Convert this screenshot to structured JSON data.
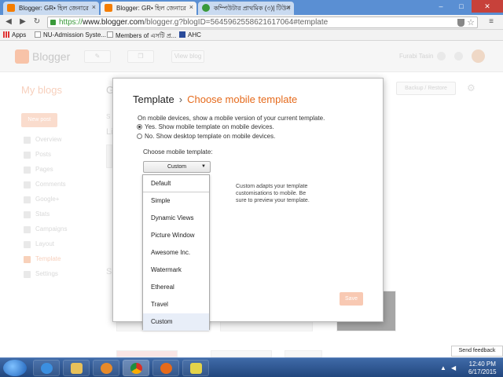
{
  "browser": {
    "tabs": [
      {
        "label": "Blogger: GR• হিল জেনারে",
        "active": false
      },
      {
        "label": "Blogger: GR• হিল জেনারে",
        "active": true
      },
      {
        "label": "কম্পিউটার প্রাথমিক (৩)| টিউন",
        "active": false
      }
    ],
    "url": {
      "scheme": "https://",
      "host": "www.blogger.com",
      "path": "/blogger.g?blogID=5645962558621617064#template"
    },
    "bookmarks": [
      "Apps",
      "NU-Admission Syste...",
      "Members of এসটি প্র...",
      "AHC"
    ],
    "window_controls": [
      "–",
      "□",
      "✕"
    ]
  },
  "blogger": {
    "logo_text": "Blogger",
    "view_blog": "View blog",
    "user_name": "Furabi Tasin",
    "my_blogs": "My blogs",
    "partial_title": "G",
    "backup_restore": "Backup / Restore",
    "new_post": "New post",
    "partial_labels": {
      "s1": "S",
      "l1": "Li",
      "s2": "S"
    },
    "sidebar": [
      "Overview",
      "Posts",
      "Pages",
      "Comments",
      "Google+",
      "Stats",
      "Campaigns",
      "Layout",
      "Template",
      "Settings"
    ],
    "send_feedback": "Send feedback"
  },
  "modal": {
    "breadcrumb": "Template",
    "separator": "›",
    "title": "Choose mobile template",
    "description": "On mobile devices, show a mobile version of your current template.",
    "option_yes": "Yes. Show mobile template on mobile devices.",
    "option_no": "No. Show desktop template on mobile devices.",
    "choose_label": "Choose mobile template:",
    "selected": "Custom",
    "menu_items": [
      "Default",
      "Simple",
      "Dynamic Views",
      "Picture Window",
      "Awesome Inc.",
      "Watermark",
      "Ethereal",
      "Travel",
      "Custom"
    ],
    "help_text": "Custom adapts your template customisations to mobile. Be sure to preview your template.",
    "save_button": "Save"
  },
  "taskbar": {
    "time": "12:40 PM",
    "date": "6/17/2015"
  },
  "colors": {
    "accent": "#e56a1c",
    "tabstrip": "#5a8fd3",
    "taskbar": "#22477e"
  }
}
